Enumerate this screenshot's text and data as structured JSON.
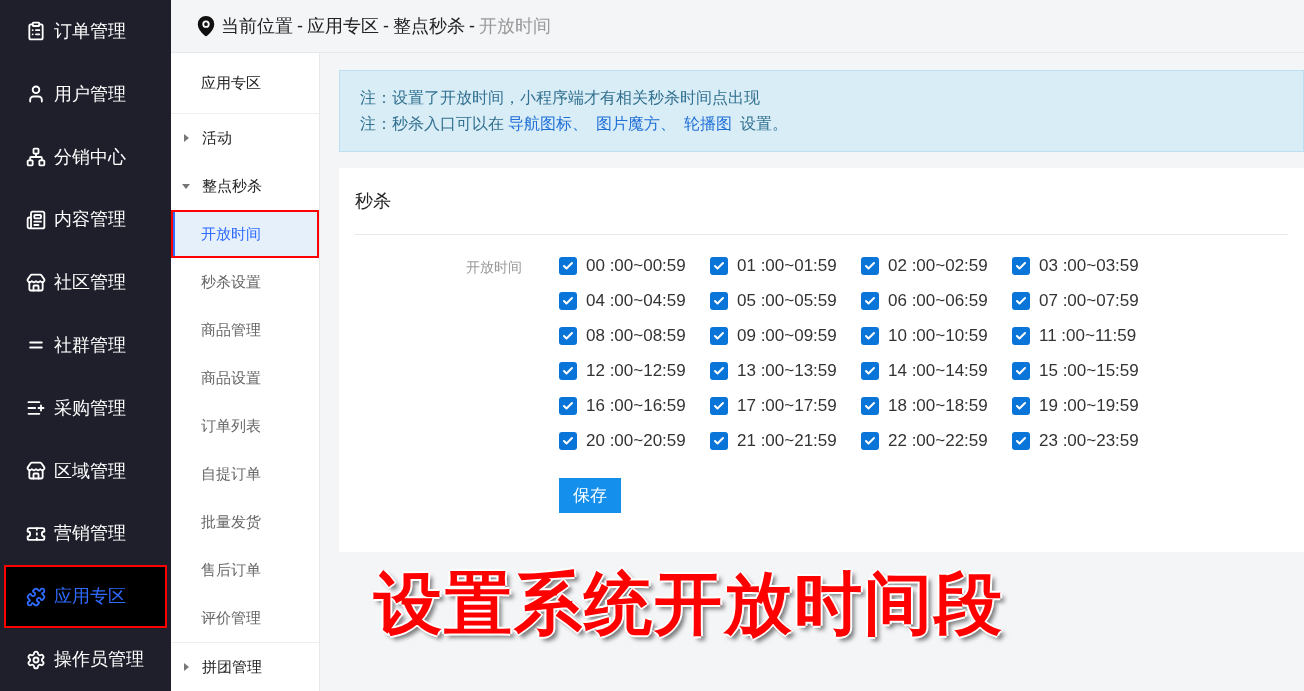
{
  "sidebar": {
    "items": [
      {
        "label": "订单管理",
        "selected": false,
        "highlighted": false
      },
      {
        "label": "用户管理",
        "selected": false,
        "highlighted": false
      },
      {
        "label": "分销中心",
        "selected": false,
        "highlighted": false
      },
      {
        "label": "内容管理",
        "selected": false,
        "highlighted": false
      },
      {
        "label": "社区管理",
        "selected": false,
        "highlighted": false
      },
      {
        "label": "社群管理",
        "selected": false,
        "highlighted": false
      },
      {
        "label": "采购管理",
        "selected": false,
        "highlighted": false
      },
      {
        "label": "区域管理",
        "selected": false,
        "highlighted": false
      },
      {
        "label": "营销管理",
        "selected": false,
        "highlighted": false
      },
      {
        "label": "应用专区",
        "selected": true,
        "highlighted": true
      },
      {
        "label": "操作员管理",
        "selected": false,
        "highlighted": false
      }
    ]
  },
  "breadcrumb": {
    "items": [
      {
        "label": "当前位置",
        "current": false
      },
      {
        "label": "应用专区",
        "current": false
      },
      {
        "label": "整点秒杀",
        "current": false
      },
      {
        "label": "开放时间",
        "current": true
      }
    ],
    "separator": "-"
  },
  "subnav": {
    "title": "应用专区",
    "items": [
      {
        "kind": "group",
        "label": "活动",
        "expanded": false
      },
      {
        "kind": "group",
        "label": "整点秒杀",
        "expanded": true,
        "children": [
          {
            "label": "开放时间",
            "selected": true,
            "highlighted": true
          },
          {
            "label": "秒杀设置",
            "selected": false,
            "highlighted": false
          },
          {
            "label": "商品管理",
            "selected": false,
            "highlighted": false
          },
          {
            "label": "商品设置",
            "selected": false,
            "highlighted": false
          },
          {
            "label": "订单列表",
            "selected": false,
            "highlighted": false
          },
          {
            "label": "自提订单",
            "selected": false,
            "highlighted": false
          },
          {
            "label": "批量发货",
            "selected": false,
            "highlighted": false
          },
          {
            "label": "售后订单",
            "selected": false,
            "highlighted": false
          },
          {
            "label": "评价管理",
            "selected": false,
            "highlighted": false
          }
        ]
      },
      {
        "kind": "group",
        "label": "拼团管理",
        "expanded": false
      }
    ]
  },
  "notice": {
    "lines": [
      [
        {
          "kind": "text",
          "text": "注：设置了开放时间，小程序端才有相关秒杀时间点出现"
        }
      ],
      [
        {
          "kind": "text",
          "text": "注：秒杀入口可以在 "
        },
        {
          "kind": "link",
          "text": "导航图标、"
        },
        {
          "kind": "link",
          "text": "图片魔方、"
        },
        {
          "kind": "link",
          "text": "轮播图"
        },
        {
          "kind": "text",
          "text": "设置。"
        }
      ]
    ]
  },
  "card": {
    "title": "秒杀",
    "field_label": "开放时间",
    "options": [
      {
        "label": "00 :00~00:59",
        "checked": true
      },
      {
        "label": "01 :00~01:59",
        "checked": true
      },
      {
        "label": "02 :00~02:59",
        "checked": true
      },
      {
        "label": "03 :00~03:59",
        "checked": true
      },
      {
        "label": "04 :00~04:59",
        "checked": true
      },
      {
        "label": "05 :00~05:59",
        "checked": true
      },
      {
        "label": "06 :00~06:59",
        "checked": true
      },
      {
        "label": "07 :00~07:59",
        "checked": true
      },
      {
        "label": "08 :00~08:59",
        "checked": true
      },
      {
        "label": "09 :00~09:59",
        "checked": true
      },
      {
        "label": "10 :00~10:59",
        "checked": true
      },
      {
        "label": "11 :00~11:59",
        "checked": true
      },
      {
        "label": "12 :00~12:59",
        "checked": true
      },
      {
        "label": "13 :00~13:59",
        "checked": true
      },
      {
        "label": "14 :00~14:59",
        "checked": true
      },
      {
        "label": "15 :00~15:59",
        "checked": true
      },
      {
        "label": "16 :00~16:59",
        "checked": true
      },
      {
        "label": "17 :00~17:59",
        "checked": true
      },
      {
        "label": "18 :00~18:59",
        "checked": true
      },
      {
        "label": "19 :00~19:59",
        "checked": true
      },
      {
        "label": "20 :00~20:59",
        "checked": true
      },
      {
        "label": "21 :00~21:59",
        "checked": true
      },
      {
        "label": "22 :00~22:59",
        "checked": true
      },
      {
        "label": "23 :00~23:59",
        "checked": true
      }
    ],
    "save_button": "保存"
  },
  "caption": "设置系统开放时间段"
}
